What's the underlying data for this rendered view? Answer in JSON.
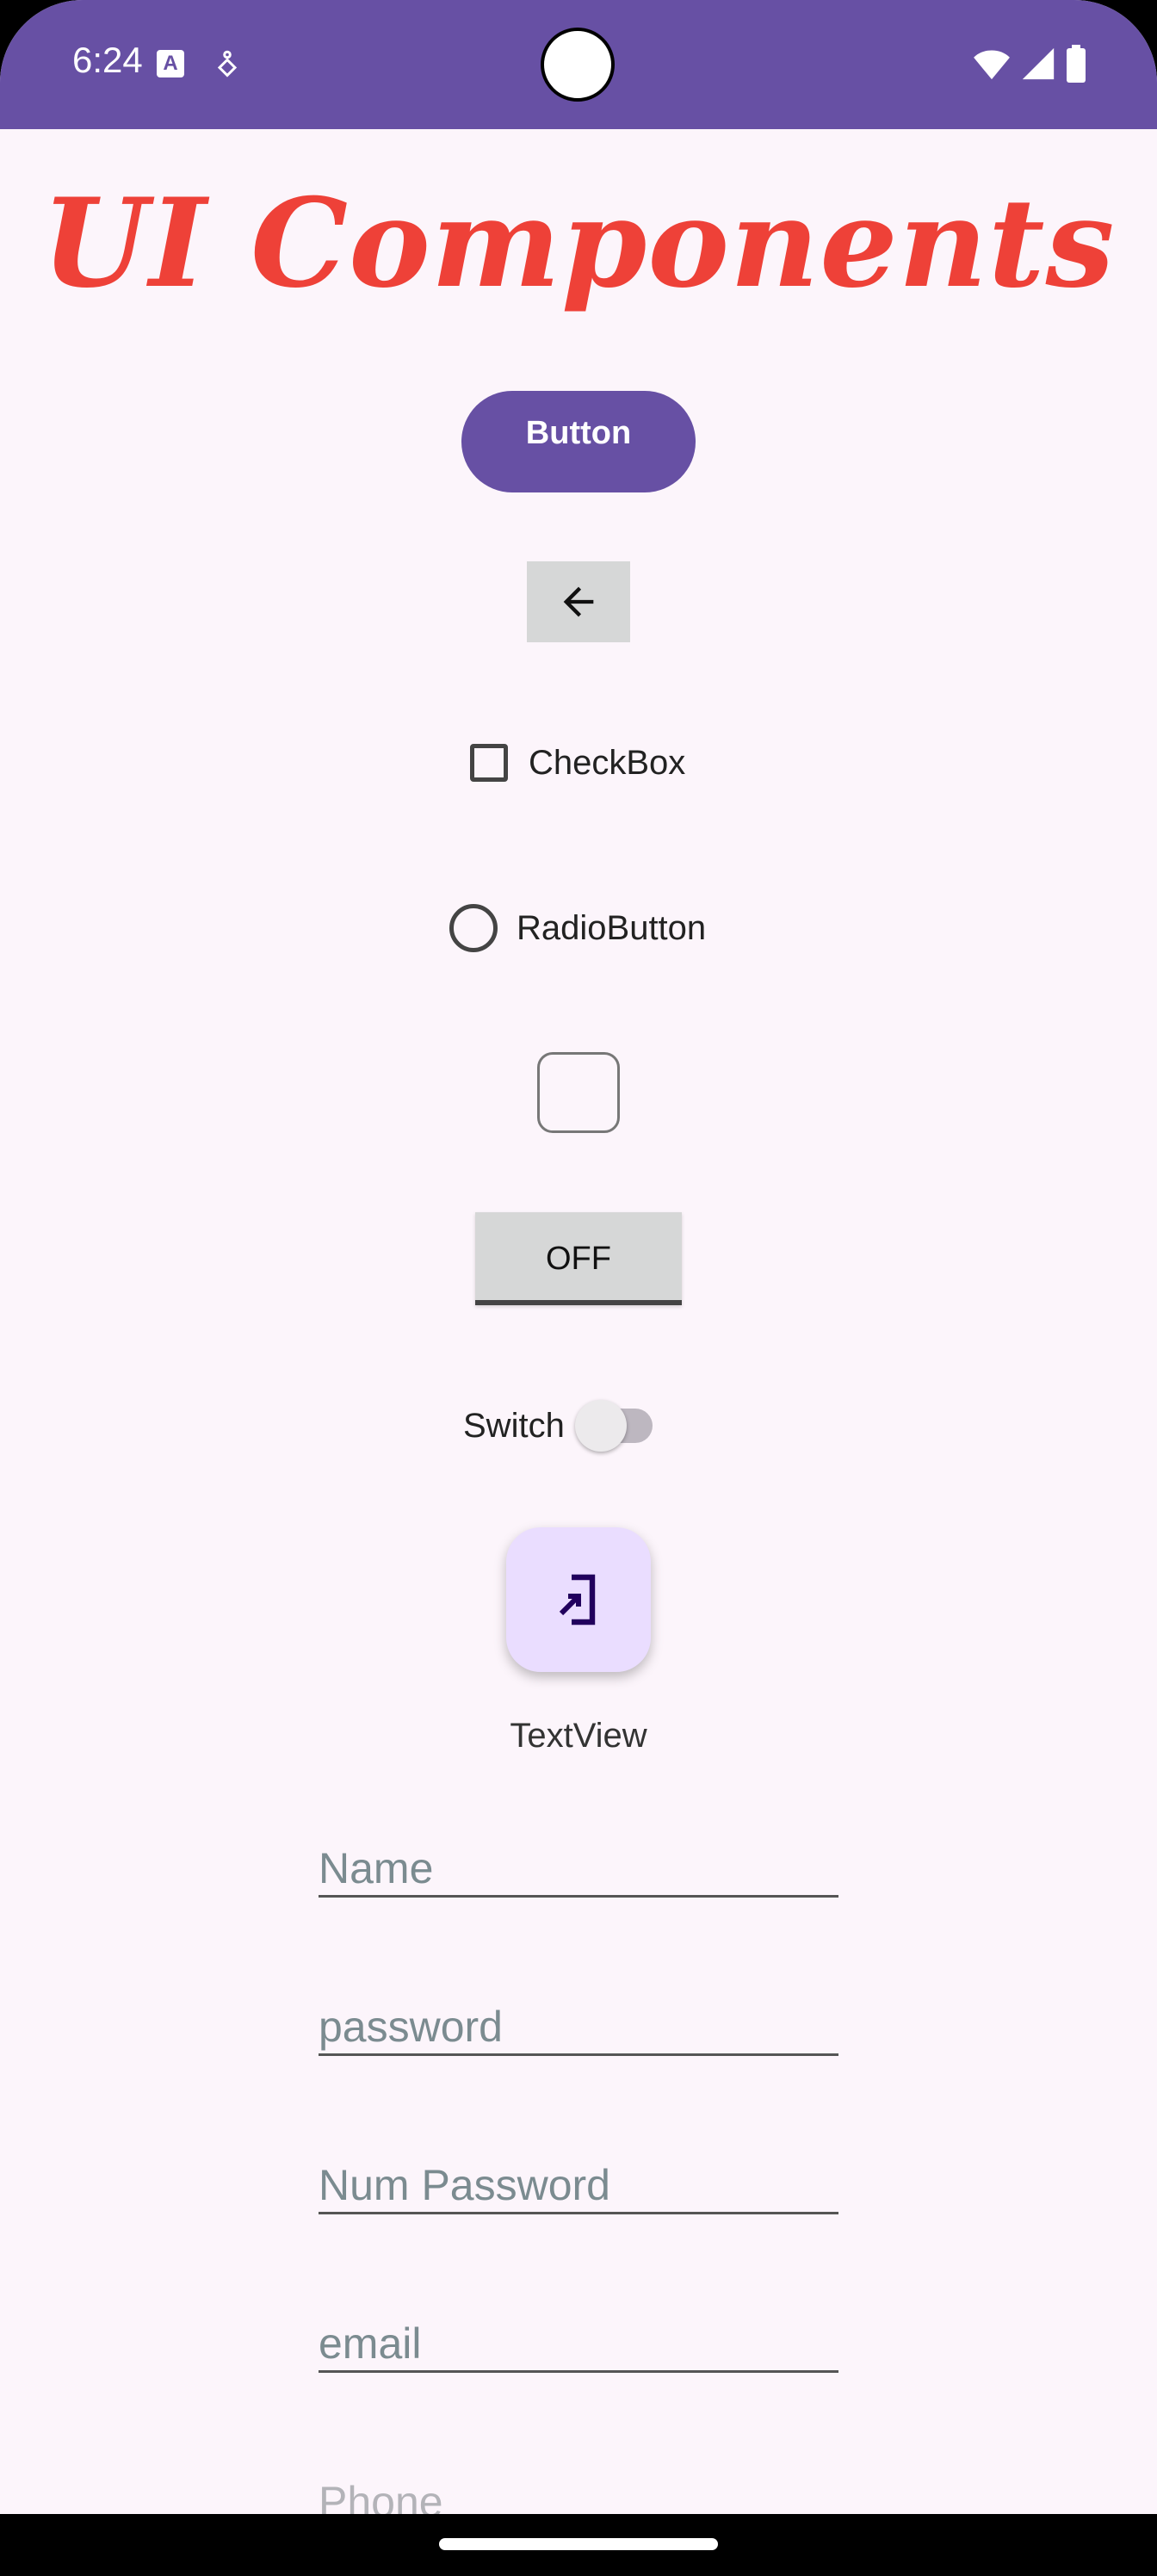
{
  "status_bar": {
    "time": "6:24",
    "notification_icon_letter": "A",
    "color": "#6750a4"
  },
  "title": "UI Components",
  "button": {
    "label": "Button"
  },
  "image_button": {
    "icon": "arrow-back-icon"
  },
  "checkbox": {
    "label": "CheckBox",
    "checked": false
  },
  "radio": {
    "label": "RadioButton",
    "checked": false
  },
  "toggle_button": {
    "label": "OFF"
  },
  "switch": {
    "label": "Switch",
    "on": false
  },
  "fab": {
    "icon": "login-icon"
  },
  "textview": "TextView",
  "fields": {
    "name": {
      "placeholder": "Name",
      "value": ""
    },
    "password": {
      "placeholder": "password",
      "value": ""
    },
    "num_password": {
      "placeholder": "Num Password",
      "value": ""
    },
    "email": {
      "placeholder": "email",
      "value": ""
    },
    "phone": {
      "placeholder": "Phone",
      "value": ""
    }
  },
  "colors": {
    "primary": "#6750a4",
    "title": "#ee4138",
    "background": "#fcf5fb",
    "fab": "#eaddff"
  }
}
